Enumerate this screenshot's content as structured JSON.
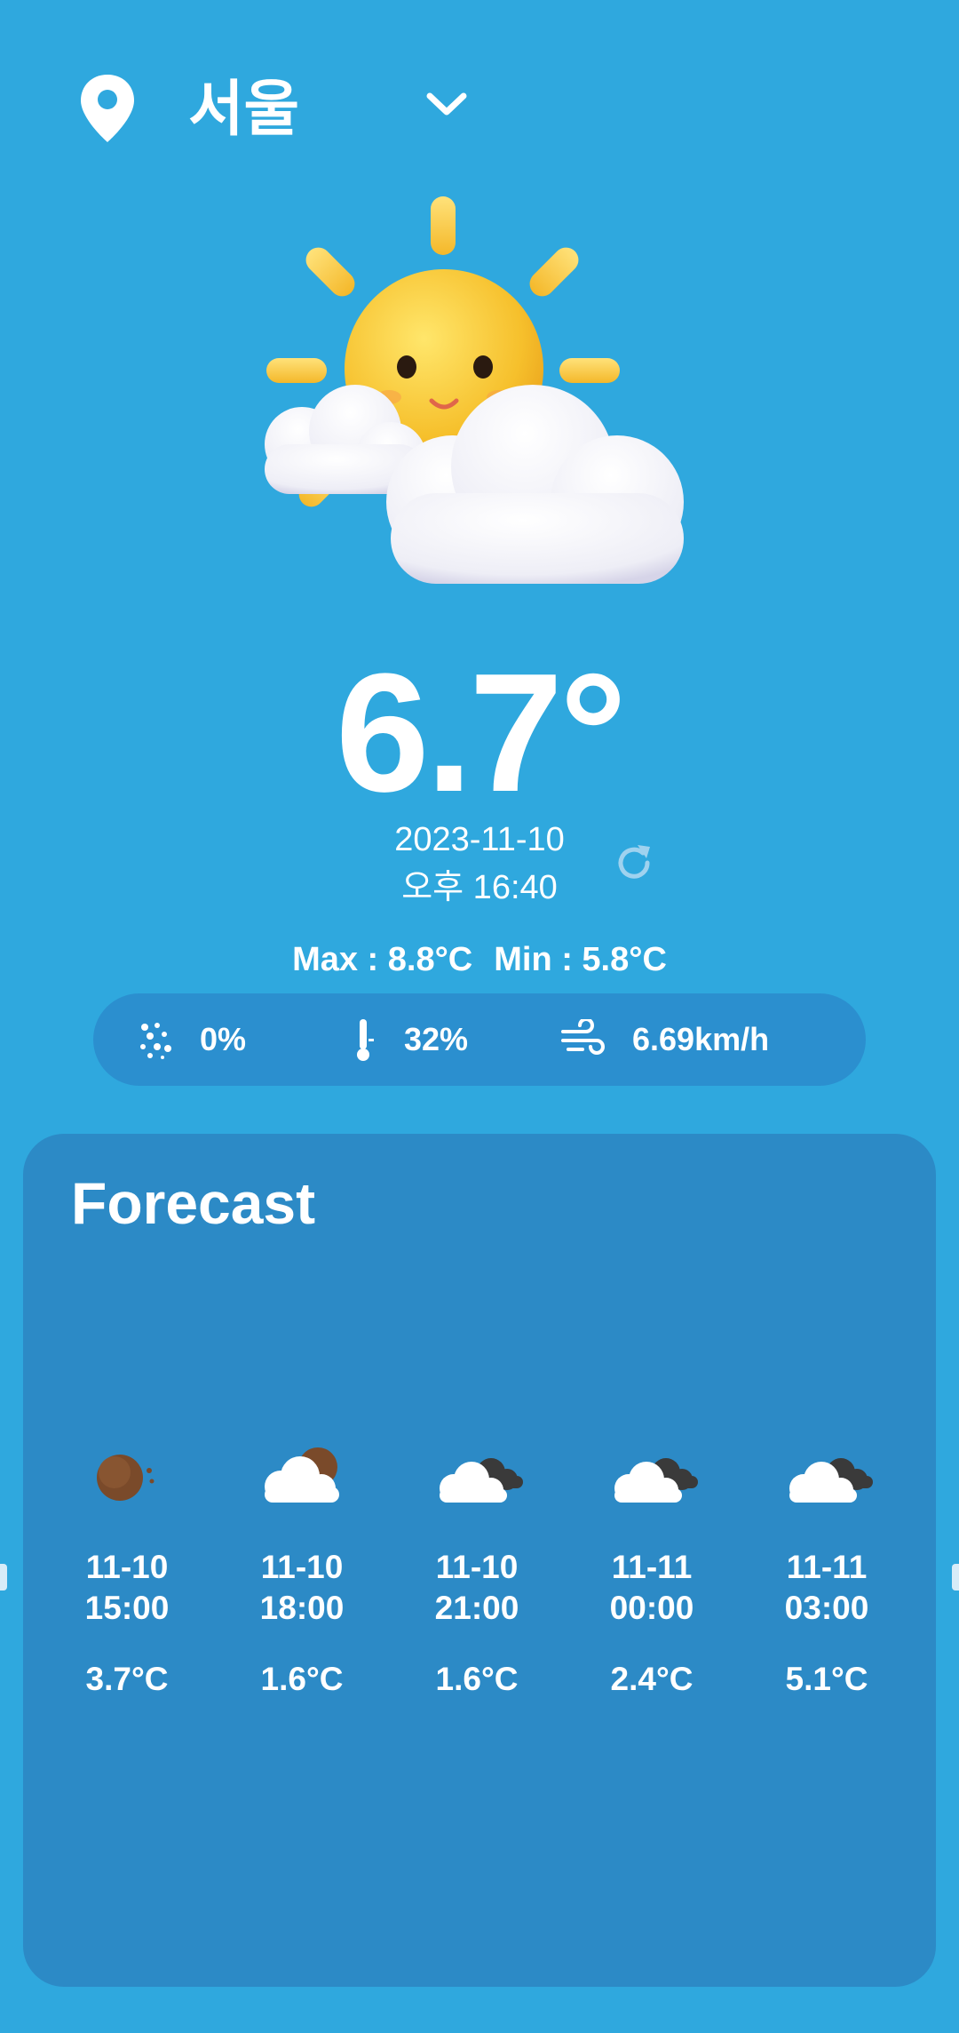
{
  "location": {
    "city": "서울"
  },
  "current": {
    "temperature": "6.7°",
    "date": "2023-11-10",
    "time": "오후 16:40",
    "max_label": "Max : 8.8°C",
    "min_label": "Min : 5.8°C"
  },
  "stats": {
    "precipitation": "0%",
    "humidity": "32%",
    "wind": "6.69km/h"
  },
  "forecast": {
    "title": "Forecast",
    "items": [
      {
        "datetime": "11-10\n15:00",
        "temp": "3.7°C",
        "icon": "moon-icon"
      },
      {
        "datetime": "11-10\n18:00",
        "temp": "1.6°C",
        "icon": "cloud-moon-icon"
      },
      {
        "datetime": "11-10\n21:00",
        "temp": "1.6°C",
        "icon": "clouds-icon"
      },
      {
        "datetime": "11-11\n00:00",
        "temp": "2.4°C",
        "icon": "clouds-icon"
      },
      {
        "datetime": "11-11\n03:00",
        "temp": "5.1°C",
        "icon": "clouds-icon"
      }
    ]
  },
  "colors": {
    "background": "#2fa8de",
    "stats_pill": "#2b8fcf",
    "forecast_card": "#2c8ac6",
    "text": "#ffffff"
  }
}
